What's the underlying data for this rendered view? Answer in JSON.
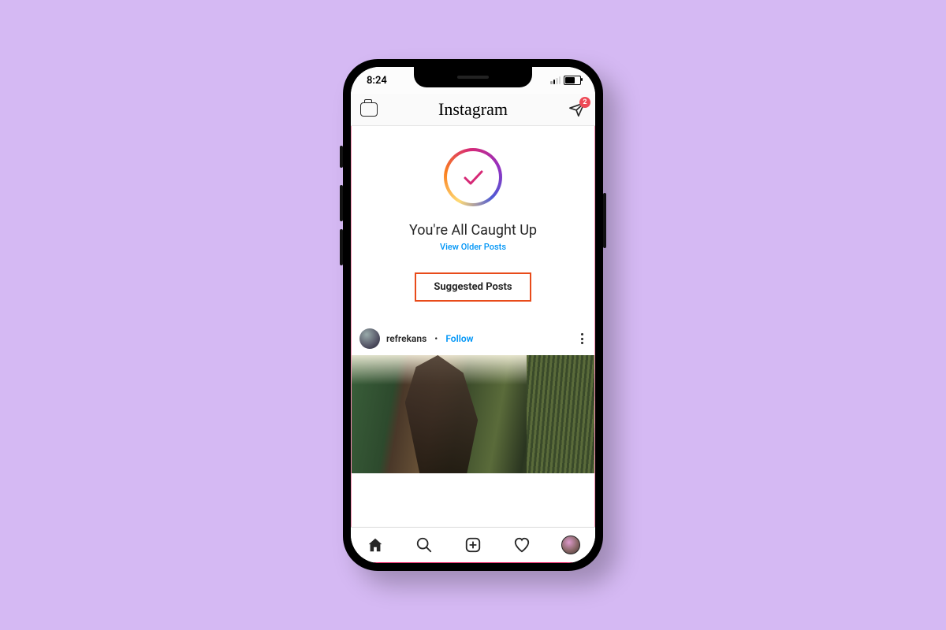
{
  "status": {
    "time": "8:24",
    "dm_badge": "2"
  },
  "header": {
    "logo": "Instagram"
  },
  "caught_up": {
    "title": "You're All Caught Up",
    "older_link": "View Older Posts"
  },
  "suggested_label": "Suggested Posts",
  "post": {
    "username": "refrekans",
    "separator": "•",
    "follow": "Follow"
  }
}
